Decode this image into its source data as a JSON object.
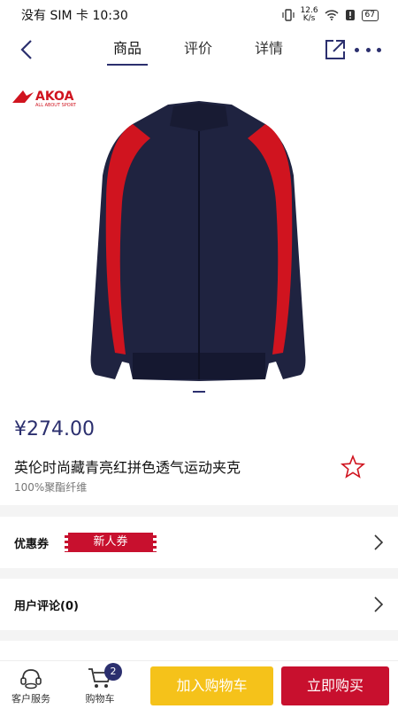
{
  "status": {
    "carrier": "没有 SIM 卡 10:30",
    "speed_top": "12.6",
    "speed_bottom": "K/s",
    "battery": "67"
  },
  "nav": {
    "tabs": [
      "商品",
      "评价",
      "详情"
    ],
    "active_tab": 0
  },
  "brand": {
    "name": "AKOA",
    "tagline": "ALL ABOUT SPORT"
  },
  "product": {
    "price": "¥274.00",
    "title": "英伦时尚藏青亮红拼色透气运动夹克",
    "material": "100%聚酯纤维",
    "colors": {
      "navy": "#1f2340",
      "red": "#d0141f",
      "accent": "#2b2f6e"
    }
  },
  "coupon_row": {
    "label": "优惠券",
    "coupon": "新人券"
  },
  "review_row": {
    "label": "用户评论(0)"
  },
  "bottom": {
    "service": "客户服务",
    "cart": "购物车",
    "cart_count": "2",
    "add_to_cart": "加入购物车",
    "buy_now": "立即购买"
  }
}
